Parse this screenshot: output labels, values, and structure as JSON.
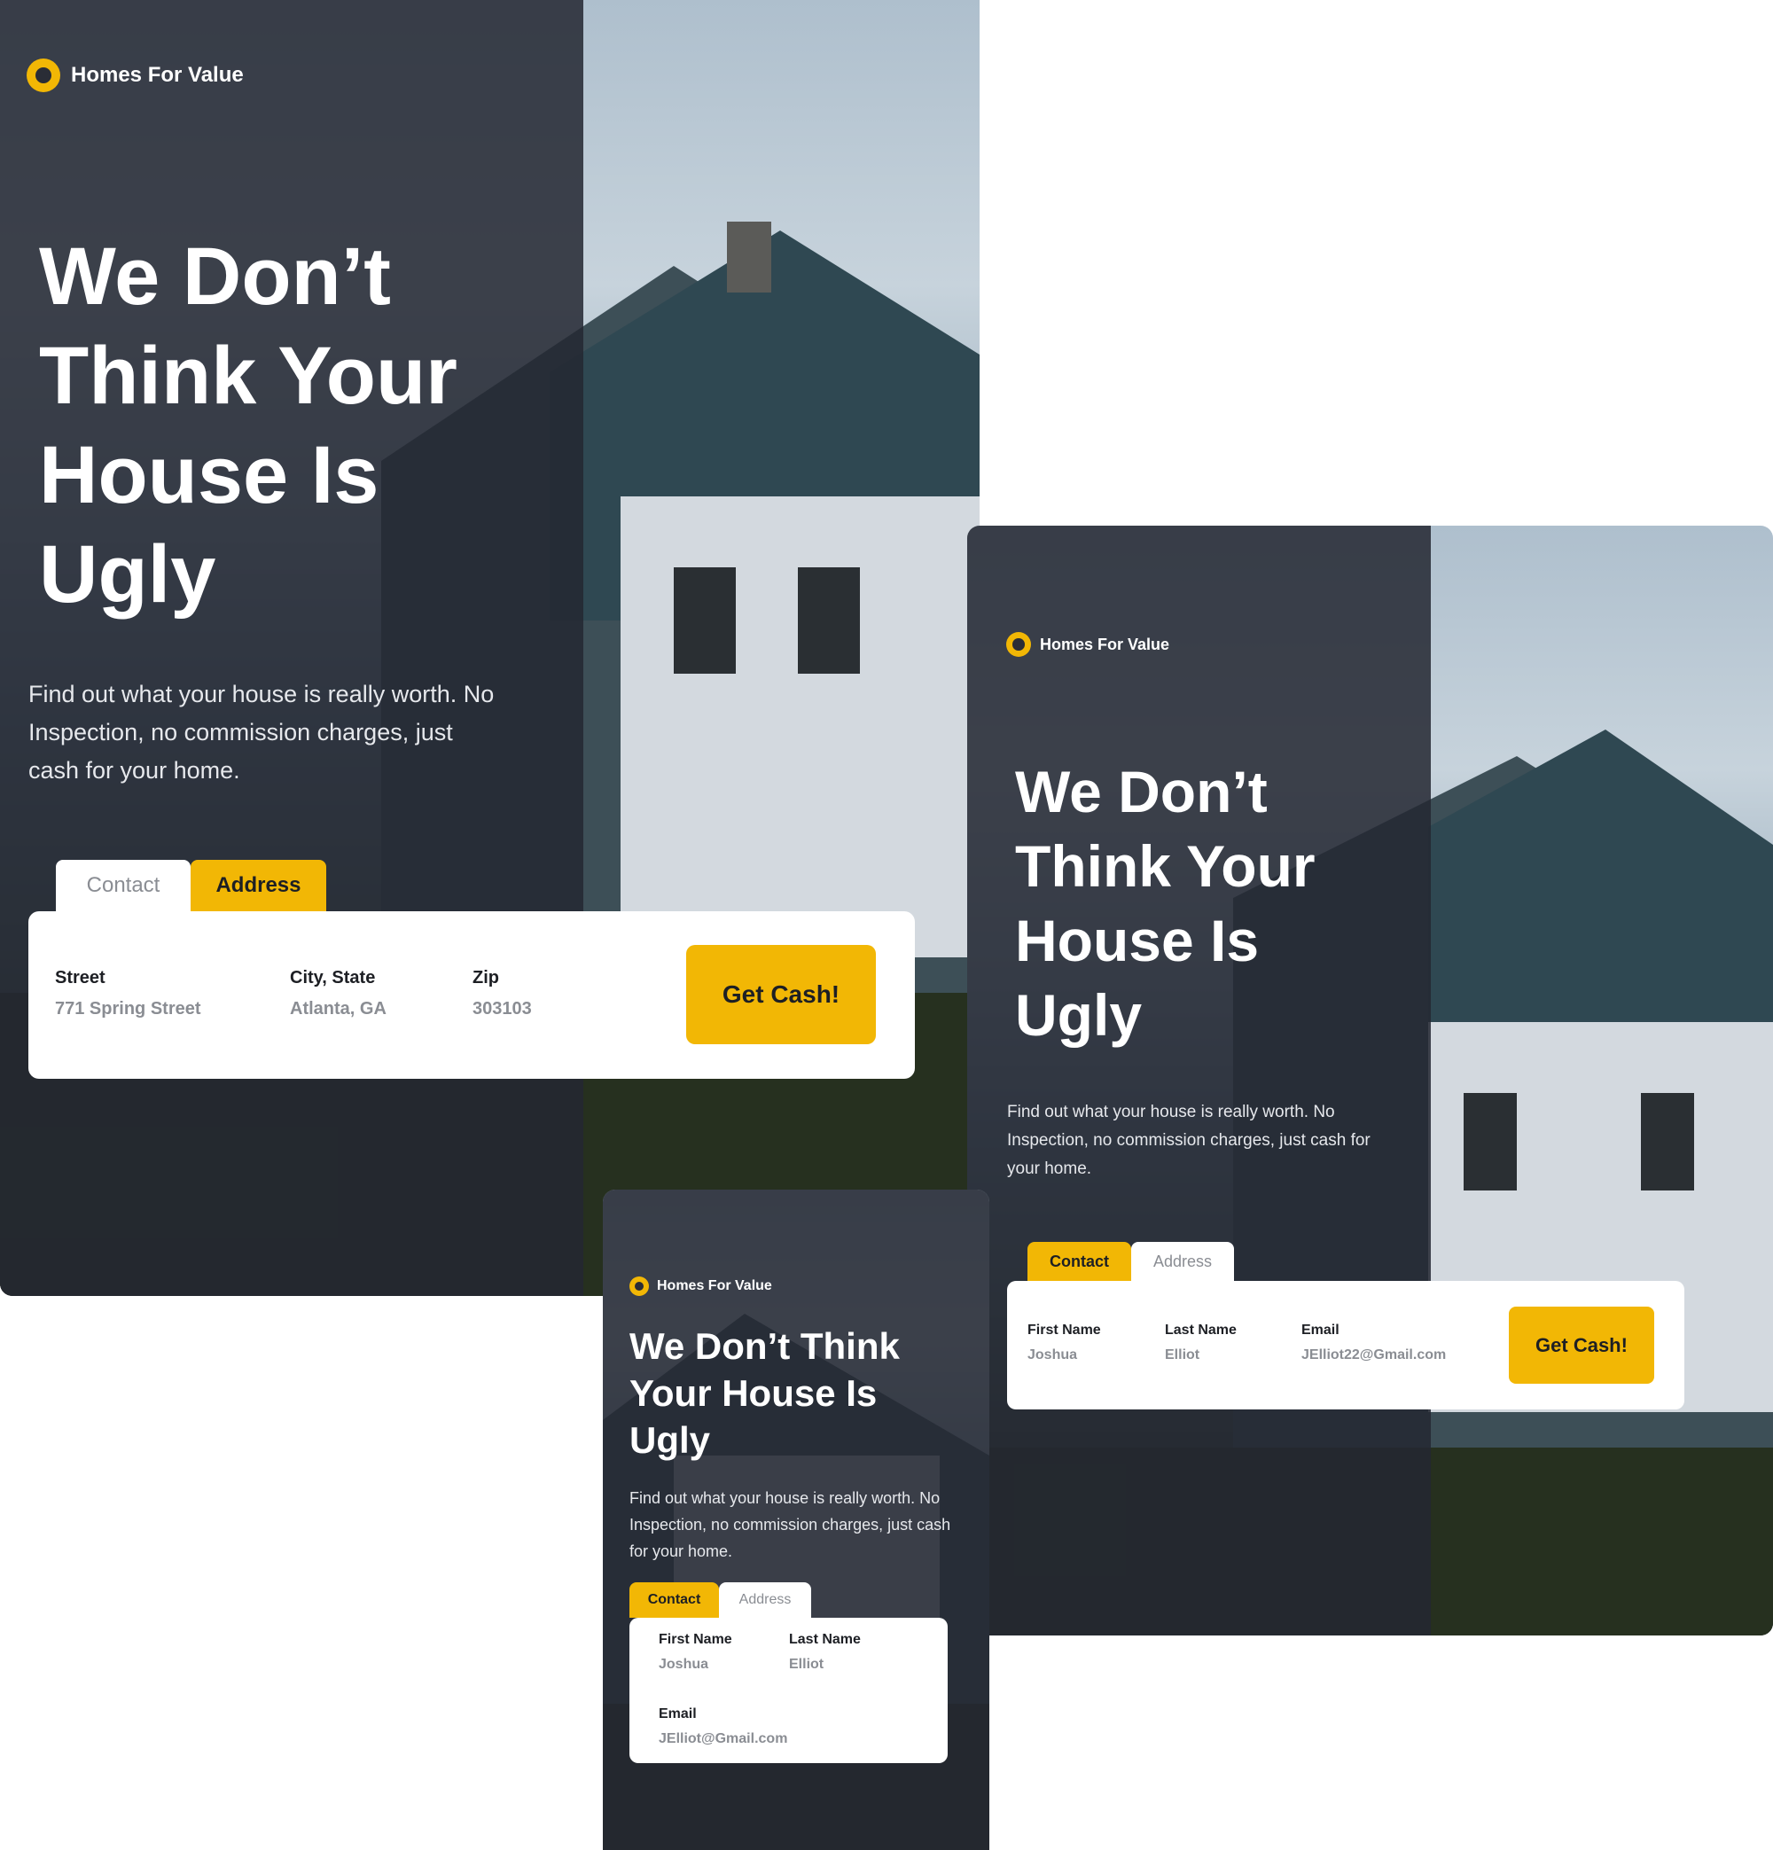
{
  "brand": {
    "name": "Homes For Value",
    "accent": "#f2b705",
    "panel": "#242832"
  },
  "desktop": {
    "headline": "We Don’t Think Your House Is Ugly",
    "subtext": "Find out what your house is really worth. No Inspection, no commission charges, just cash for your home.",
    "tabs": [
      {
        "label": "Contact",
        "active": false
      },
      {
        "label": "Address",
        "active": true
      }
    ],
    "fields": [
      {
        "label": "Street",
        "value": "771 Spring Street"
      },
      {
        "label": "City, State",
        "value": "Atlanta, GA"
      },
      {
        "label": "Zip",
        "value": "303103"
      }
    ],
    "cta": "Get Cash!"
  },
  "tablet": {
    "headline": "We Don’t Think Your House Is Ugly",
    "subtext": "Find out what your house is really worth. No Inspection, no commission charges, just cash for your home.",
    "tabs": [
      {
        "label": "Contact",
        "active": true
      },
      {
        "label": "Address",
        "active": false
      }
    ],
    "fields": [
      {
        "label": "First Name",
        "value": "Joshua"
      },
      {
        "label": "Last Name",
        "value": "Elliot"
      },
      {
        "label": "Email",
        "value": "JElliot22@Gmail.com"
      }
    ],
    "cta": "Get Cash!"
  },
  "mobile": {
    "headline": "We Don’t Think Your House Is Ugly",
    "subtext": "Find out what your house is really worth. No Inspection, no commission charges, just cash for your home.",
    "tabs": [
      {
        "label": "Contact",
        "active": true
      },
      {
        "label": "Address",
        "active": false
      }
    ],
    "fields": [
      {
        "label": "First Name",
        "value": "Joshua"
      },
      {
        "label": "Last Name",
        "value": "Elliot"
      },
      {
        "label": "Email",
        "value": "JElliot@Gmail.com"
      }
    ]
  }
}
